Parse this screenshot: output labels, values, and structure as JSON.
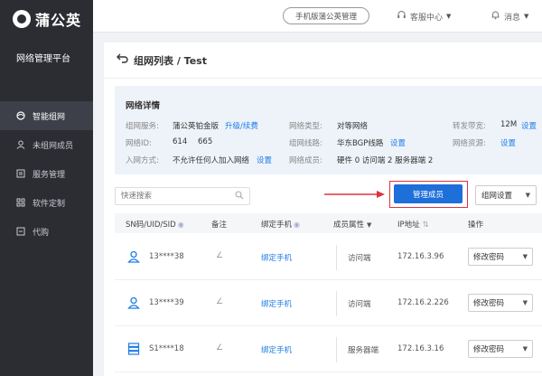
{
  "brand": {
    "name": "蒲公英",
    "platform": "网络管理平台"
  },
  "nav": [
    {
      "label": "智能组网",
      "icon": "network-icon",
      "active": true
    },
    {
      "label": "未组网成员",
      "icon": "user-icon",
      "active": false
    },
    {
      "label": "服务管理",
      "icon": "service-icon",
      "active": false
    },
    {
      "label": "软件定制",
      "icon": "grid-icon",
      "active": false
    },
    {
      "label": "代购",
      "icon": "cart-icon",
      "active": false
    }
  ],
  "header": {
    "mobile_btn": "手机版蒲公英管理",
    "support": "客服中心",
    "messages": "消息"
  },
  "page": {
    "title": "组网列表 / Test"
  },
  "details": {
    "title": "网络详情",
    "service_label": "组网服务:",
    "service_value": "蒲公英铂金版",
    "upgrade_link": "升级/续费",
    "network_id_label": "网络ID:",
    "network_id_value_a": "614",
    "network_id_value_b": "665",
    "join_label": "入网方式:",
    "join_value": "不允许任何人加入网络",
    "join_link": "设置",
    "type_label": "网络类型:",
    "type_value": "对等网络",
    "line_label": "组网线路:",
    "line_value": "华东BGP线路",
    "line_link": "设置",
    "members_label": "网络成员:",
    "members_value": "硬件 0 访问端 2 服务器端 2",
    "bandwidth_label": "转发带宽:",
    "bandwidth_value": "12M",
    "bandwidth_link": "设置",
    "resource_label": "网络资源:",
    "resource_link": "设置"
  },
  "toolbar": {
    "search_placeholder": "快速搜索",
    "manage_btn": "管理成员",
    "group_settings": "组网设置"
  },
  "table": {
    "headers": {
      "sn": "SN码/UID/SID",
      "remark": "备注",
      "phone": "绑定手机",
      "attr": "成员属性",
      "ip": "IP地址",
      "op": "操作"
    },
    "rows": [
      {
        "id": "13****38",
        "phone": "绑定手机",
        "attr": "访问端",
        "ip": "172.16.3.96",
        "op": "修改密码",
        "icon": "user-icon"
      },
      {
        "id": "13****39",
        "phone": "绑定手机",
        "attr": "访问端",
        "ip": "172.16.2.226",
        "op": "修改密码",
        "icon": "user-icon"
      },
      {
        "id": "S1****18",
        "phone": "绑定手机",
        "attr": "服务器端",
        "ip": "172.16.3.16",
        "op": "修改密码",
        "icon": "server-icon"
      }
    ]
  },
  "colors": {
    "accent": "#1e6fd9",
    "sidebar": "#2b2d33",
    "highlight": "#e0323e"
  }
}
